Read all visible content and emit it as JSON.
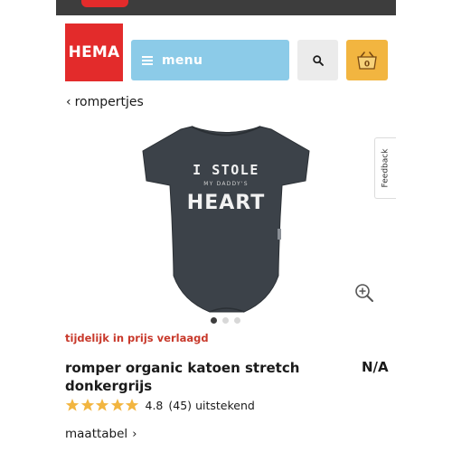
{
  "header": {
    "logo_text": "HEMA",
    "menu_label": "menu",
    "search_icon": "search-icon",
    "cart_icon": "basket-icon",
    "cart_count": "0",
    "colors": {
      "topbar": "#3d3d3d",
      "brand_red": "#e32b2b",
      "menu_blue": "#8ccbe8",
      "cart_yellow": "#f2b540"
    }
  },
  "breadcrumb": {
    "label": "rompertjes"
  },
  "product": {
    "print_line1": "I STOLE",
    "print_line2": "MY DADDY'S",
    "print_line3": "HEART",
    "body_color": "#3c4249",
    "carousel": {
      "count": 3,
      "active": 1
    },
    "promo_label": "tijdelijk in prijs verlaagd",
    "title": "romper organic katoen stretch donkergrijs",
    "price": "N/A",
    "rating": {
      "score": "4.8",
      "stars_value": 4.8,
      "stars_max": 5,
      "count": "(45)",
      "verdict": "uitstekend"
    },
    "size_chart_label": "maattabel"
  },
  "feedback_tab": {
    "label": "Feedback"
  }
}
